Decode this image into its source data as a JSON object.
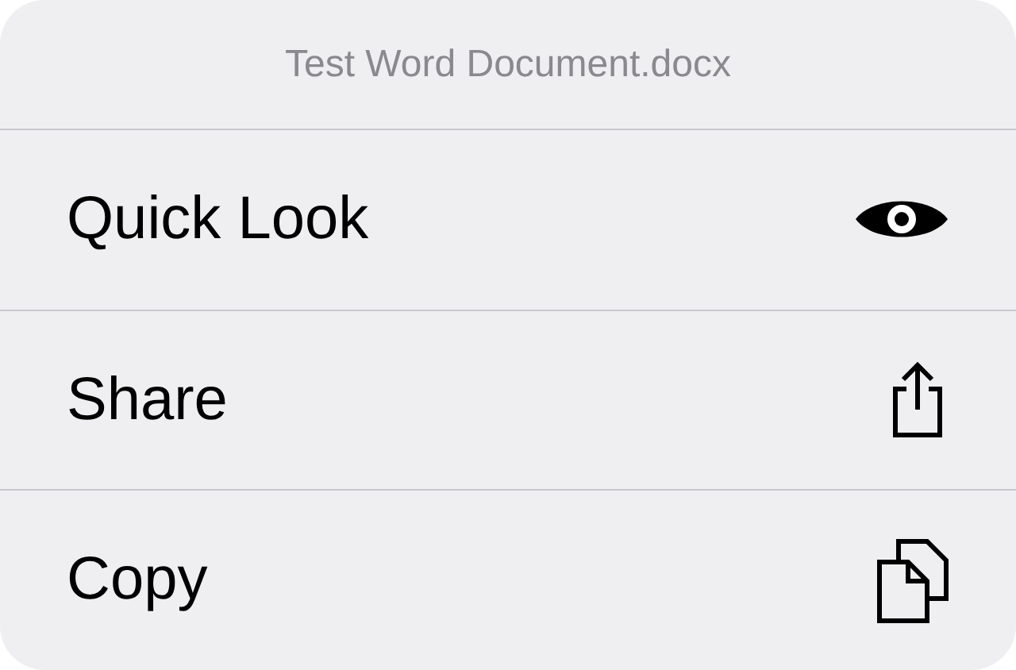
{
  "menu": {
    "title": "Test Word Document.docx",
    "items": [
      {
        "label": "Quick Look",
        "kind": "eye"
      },
      {
        "label": "Share",
        "kind": "share"
      },
      {
        "label": "Copy",
        "kind": "copy"
      }
    ]
  }
}
